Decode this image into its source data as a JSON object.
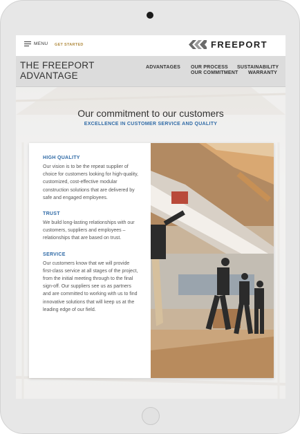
{
  "header": {
    "menu_label": "MENU",
    "cta_label": "GET STARTED",
    "logo_text": "FREEPORT"
  },
  "subnav": {
    "page_title": "THE FREEPORT\nADVANTAGE",
    "links": [
      "ADVANTAGES",
      "OUR PROCESS",
      "OUR COMMITMENT",
      "SUSTAINABILITY",
      "WARRANTY"
    ]
  },
  "main": {
    "title": "Our commitment to our customers",
    "subtitle": "EXCELLENCE IN CUSTOMER SERVICE AND QUALITY",
    "items": [
      {
        "heading": "HIGH QUALITY",
        "body": "Our vision is to be the repeat supplier of choice for customers looking for high-quality, customized, cost-effective modular construction solutions that are delivered by safe and engaged employees."
      },
      {
        "heading": "TRUST",
        "body": "We build long-lasting relationships with our customers, suppliers and employees – relationships that are based on trust."
      },
      {
        "heading": "SERVICE",
        "body": "Our customers know that we will provide first-class service at all stages of the project, from the initial meeting through to the final sign-off. Our suppliers see us as partners and are committed to working with us to find innovative solutions that will keep us at the leading edge of our field."
      }
    ]
  },
  "colors": {
    "accent_blue": "#2f6aa6",
    "accent_gold": "#b08a3e",
    "text_dark": "#333333"
  }
}
